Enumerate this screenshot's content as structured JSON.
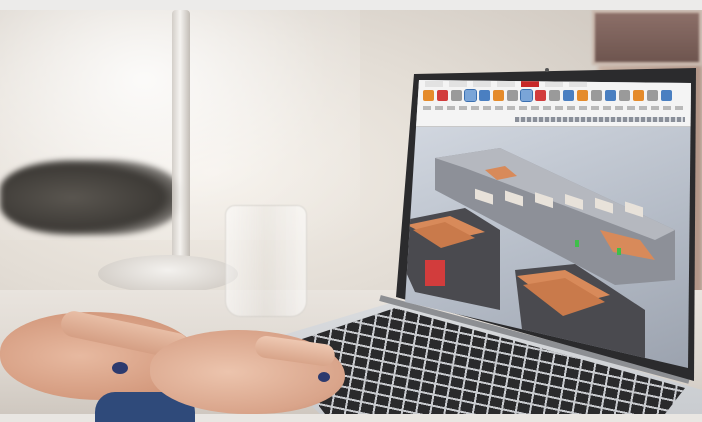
{
  "scene": {
    "description_tags": [
      "laptop",
      "cad-software",
      "hands-typing",
      "desk",
      "lamp",
      "glass"
    ],
    "colors": {
      "background": "#e3ddd5",
      "laptop_body": "#2b2b2d",
      "ribbon": "#f4f4f4",
      "accent_red": "#c62828",
      "copper_part": "#d88a5a",
      "machine_dark": "#4a4a4f",
      "skin": "#d9a48a",
      "nail_polish": "#2c3a6e"
    }
  },
  "screen": {
    "app_icons": [
      "orange-tool",
      "blue-tool",
      "red-tool",
      "gray-tool",
      "selected-tool"
    ]
  }
}
